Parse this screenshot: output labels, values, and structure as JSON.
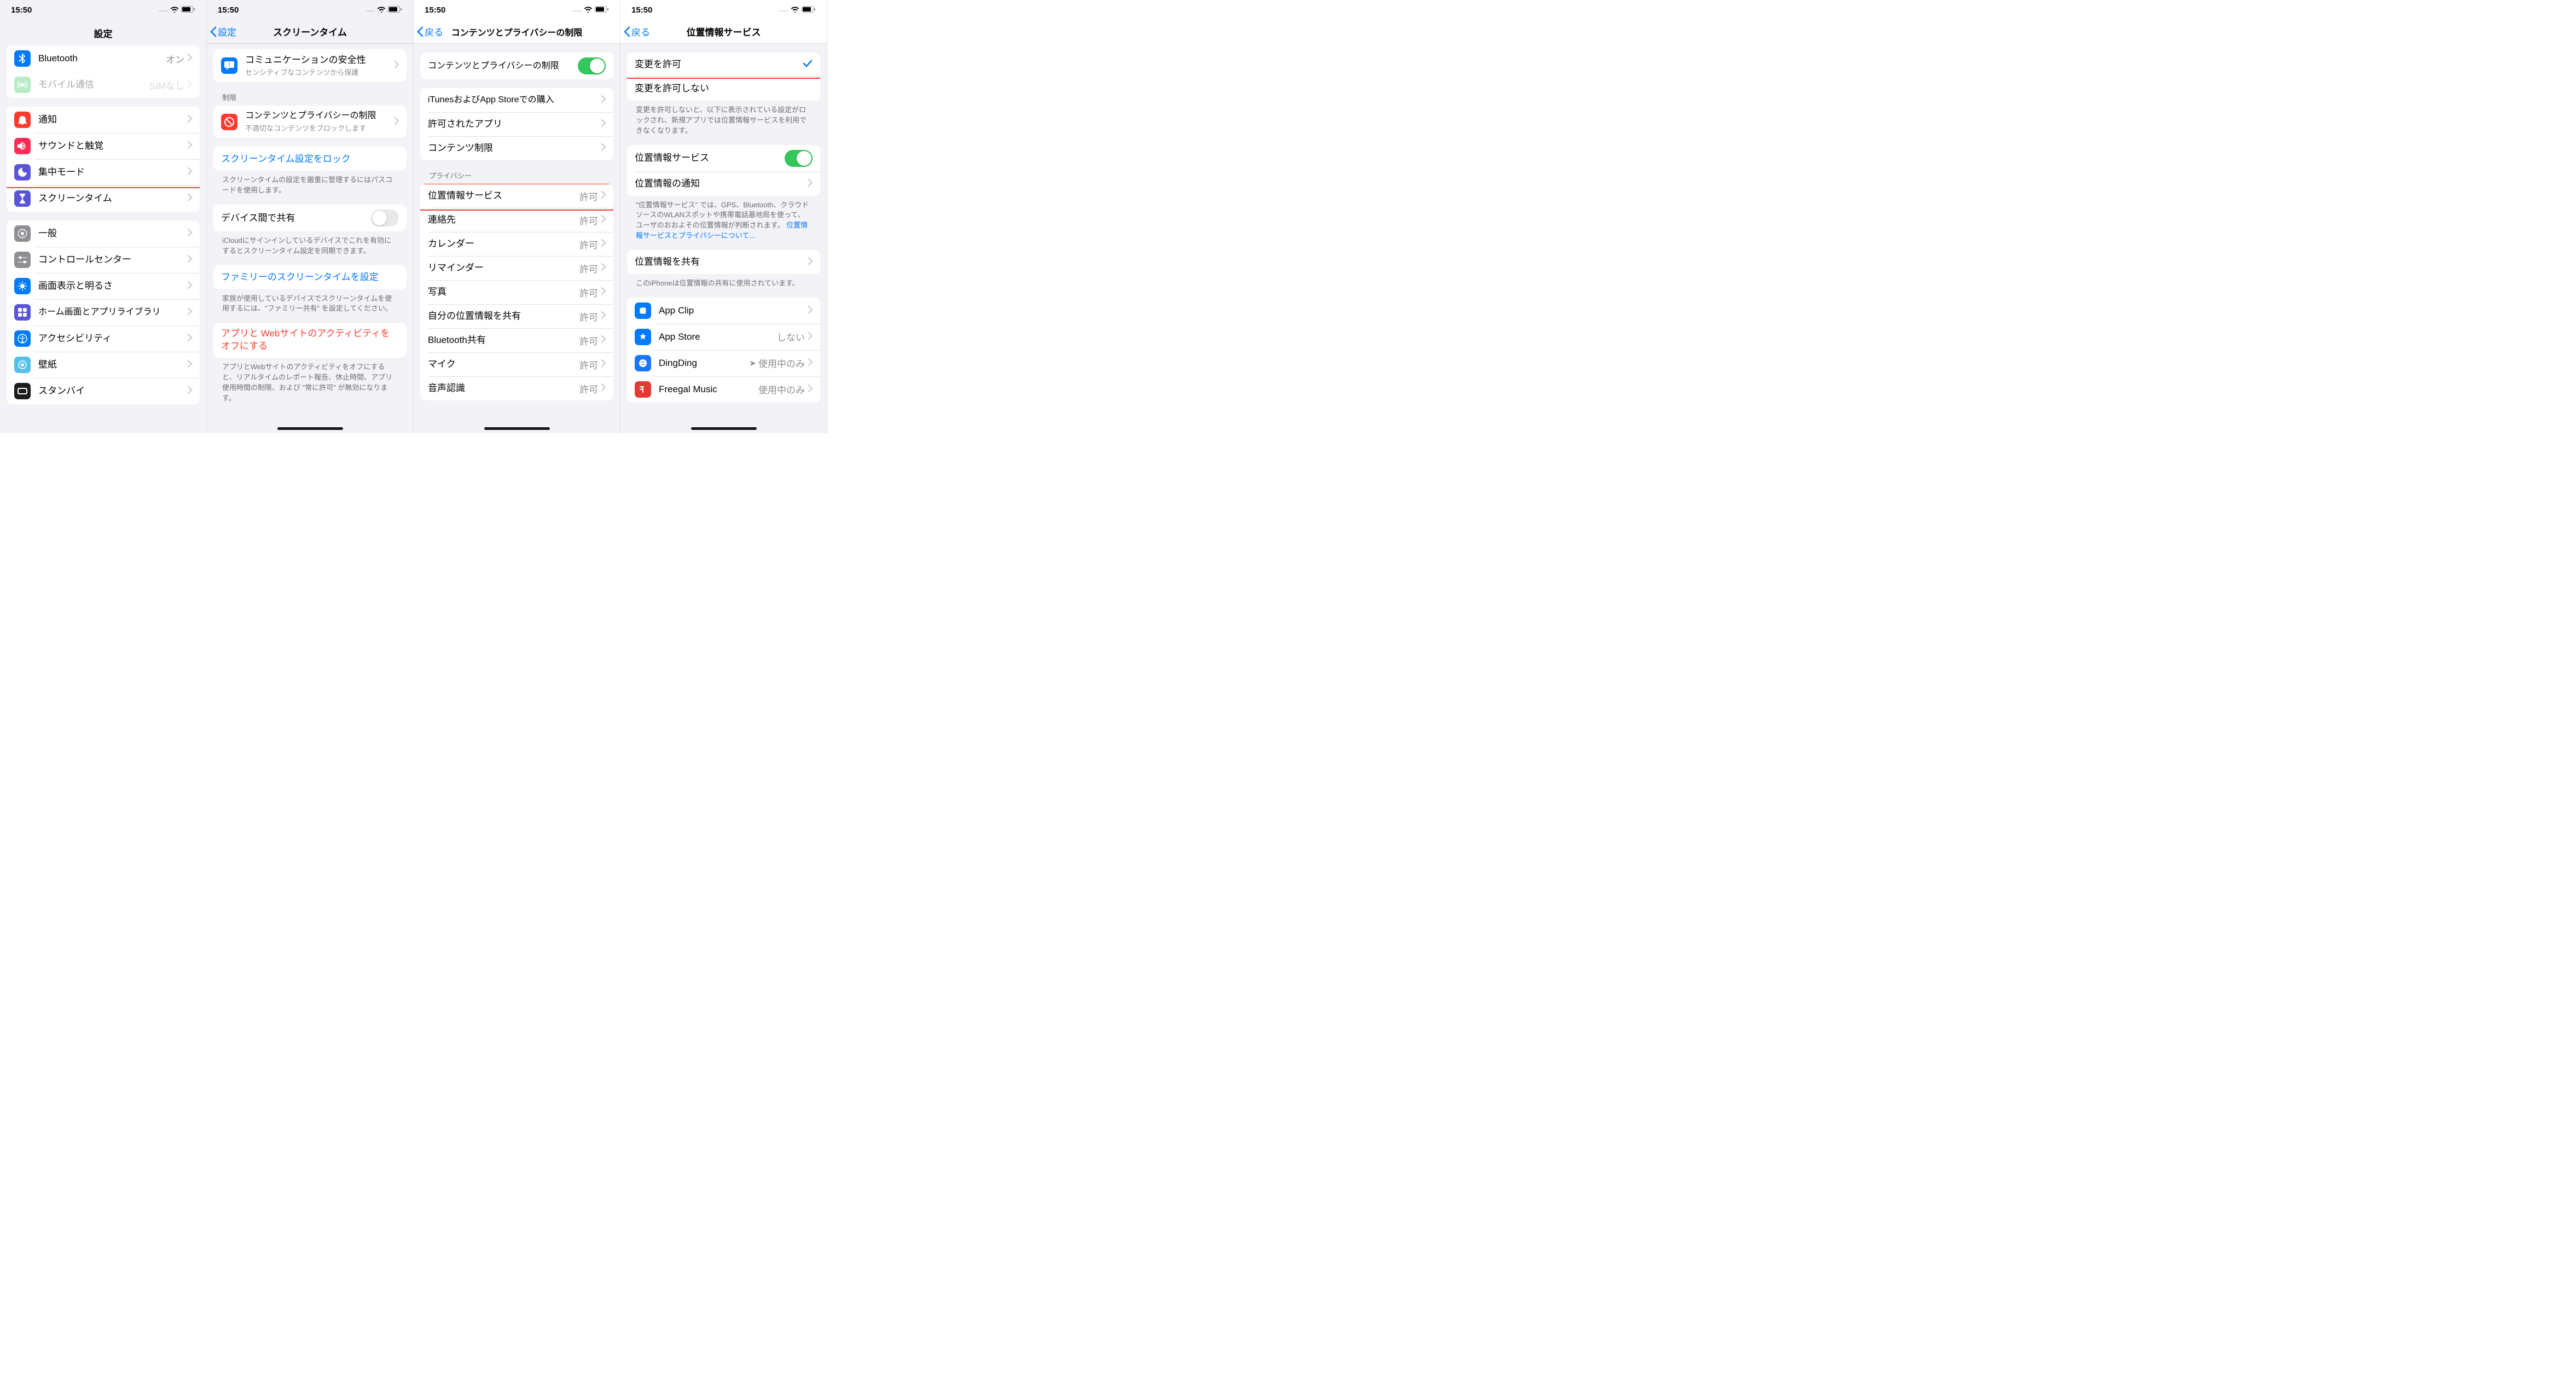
{
  "status": {
    "time": "15:50",
    "cell": "....",
    "battery": "􀛨"
  },
  "s1": {
    "title": "設定",
    "cells_top": [
      {
        "label": "Bluetooth",
        "detail": "オン"
      },
      {
        "label": "モバイル通信",
        "detail": "SIMなし",
        "faded": true
      }
    ],
    "cells_g2": [
      {
        "label": "通知"
      },
      {
        "label": "サウンドと触覚"
      },
      {
        "label": "集中モード"
      },
      {
        "label": "スクリーンタイム",
        "highlight": true
      }
    ],
    "cells_g3": [
      {
        "label": "一般"
      },
      {
        "label": "コントロールセンター"
      },
      {
        "label": "画面表示と明るさ"
      },
      {
        "label": "ホーム画面とアプリライブラリ"
      },
      {
        "label": "アクセシビリティ"
      },
      {
        "label": "壁紙"
      },
      {
        "label": "スタンバイ"
      }
    ]
  },
  "s2": {
    "back": "設定",
    "title": "スクリーンタイム",
    "cells_g1": [
      {
        "label": "コミュニケーションの安全性",
        "sub": "センシティブなコンテンツから保護"
      }
    ],
    "header1": "制限",
    "cells_g2": [
      {
        "label": "コンテンツとプライバシーの制限",
        "sub": "不適切なコンテンツをブロックします",
        "highlight": true
      }
    ],
    "cells_g3_label": "スクリーンタイム設定をロック",
    "footer_g3": "スクリーンタイムの設定を厳重に管理するにはパスコードを使用します。",
    "cells_g4_label": "デバイス間で共有",
    "footer_g4": "iCloudにサインインしているデバイスでこれを有効にするとスクリーンタイム設定を同期できます。",
    "cells_g5_label": "ファミリーのスクリーンタイムを設定",
    "footer_g5": "家族が使用しているデバイスでスクリーンタイムを使用するには、\"ファミリー共有\" を設定してください。",
    "cells_g6_label": "アプリと Webサイトのアクティビティをオフにする",
    "footer_g6": "アプリとWebサイトのアクティビティをオフにすると、リアルタイムのレポート報告、休止時間、アプリ使用時間の制限、および \"常に許可\" が無効になります。"
  },
  "s3": {
    "back": "戻る",
    "title": "コンテンツとプライバシーの制限",
    "toggle_label": "コンテンツとプライバシーの制限",
    "toggle_on": true,
    "cells_g2": [
      {
        "label": "iTunesおよびApp Storeでの購入"
      },
      {
        "label": "許可されたアプリ"
      },
      {
        "label": "コンテンツ制限"
      }
    ],
    "header_priv": "プライバシー",
    "cells_priv": [
      {
        "label": "位置情報サービス",
        "detail": "許可",
        "highlight": true
      },
      {
        "label": "連絡先",
        "detail": "許可"
      },
      {
        "label": "カレンダー",
        "detail": "許可"
      },
      {
        "label": "リマインダー",
        "detail": "許可"
      },
      {
        "label": "写真",
        "detail": "許可"
      },
      {
        "label": "自分の位置情報を共有",
        "detail": "許可"
      },
      {
        "label": "Bluetooth共有",
        "detail": "許可"
      },
      {
        "label": "マイク",
        "detail": "許可"
      },
      {
        "label": "音声認識",
        "detail": "許可"
      }
    ]
  },
  "s4": {
    "back": "戻る",
    "title": "位置情報サービス",
    "cells_g1": [
      {
        "label": "変更を許可",
        "checked": true,
        "highlight": true
      },
      {
        "label": "変更を許可しない"
      }
    ],
    "footer_g1": "変更を許可しないと、以下に表示されている設定がロックされ、新規アプリでは位置情報サービスを利用できなくなります。",
    "cells_g2_label": "位置情報サービス",
    "cells_g2_on": true,
    "cells_g2_2": "位置情報の通知",
    "footer_g2a": "\"位置情報サービス\" では、GPS、Bluetooth、クラウドソースのWLANスポットや携帯電話基地局を使って、ユーザのおおよその位置情報が判断されます。 ",
    "footer_g2link": "位置情報サービスとプライバシーについて...",
    "cells_g3_label": "位置情報を共有",
    "footer_g3": "このiPhoneは位置情報の共有に使用されています。",
    "apps": [
      {
        "label": "App Clip",
        "detail": ""
      },
      {
        "label": "App Store",
        "detail": "しない"
      },
      {
        "label": "DingDing",
        "detail": "使用中のみ",
        "arrow": true
      },
      {
        "label": "Freegal Music",
        "detail": "使用中のみ"
      }
    ]
  }
}
